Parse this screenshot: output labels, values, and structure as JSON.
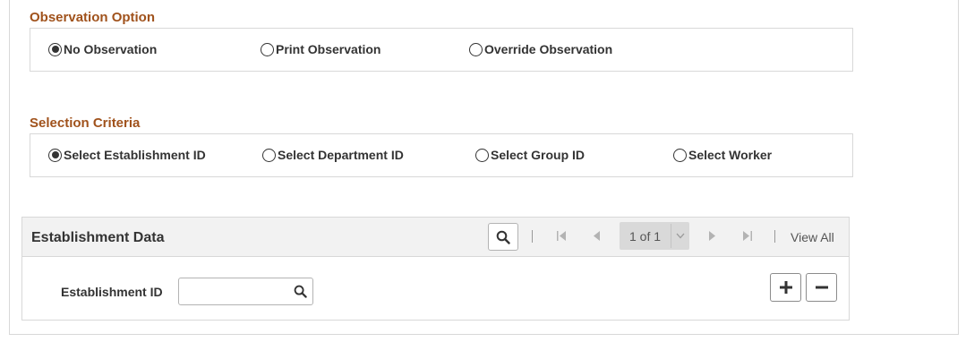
{
  "observation": {
    "title": "Observation Option",
    "options": [
      {
        "label": "No Observation",
        "checked": true
      },
      {
        "label": "Print Observation",
        "checked": false
      },
      {
        "label": "Override Observation",
        "checked": false
      }
    ]
  },
  "selection": {
    "title": "Selection Criteria",
    "options": [
      {
        "label": "Select Establishment ID",
        "checked": true
      },
      {
        "label": "Select Department ID",
        "checked": false
      },
      {
        "label": "Select Group ID",
        "checked": false
      },
      {
        "label": "Select Worker",
        "checked": false
      }
    ]
  },
  "grid": {
    "title": "Establishment Data",
    "pagination": {
      "page_label": "1 of 1",
      "view_all": "View All"
    },
    "field": {
      "label": "Establishment ID",
      "value": "",
      "placeholder": ""
    },
    "icons": {
      "search": "search-icon",
      "first": "first-page-icon",
      "prev": "previous-page-icon",
      "next": "next-page-icon",
      "last": "last-page-icon",
      "dropdown": "chevron-down-icon",
      "add": "plus-icon",
      "remove": "minus-icon"
    }
  },
  "colors": {
    "section_title": "#a0521c",
    "border": "#d8d8d8",
    "header_bg": "#f2f2f2",
    "page_select_bg": "#d9d9d9"
  }
}
